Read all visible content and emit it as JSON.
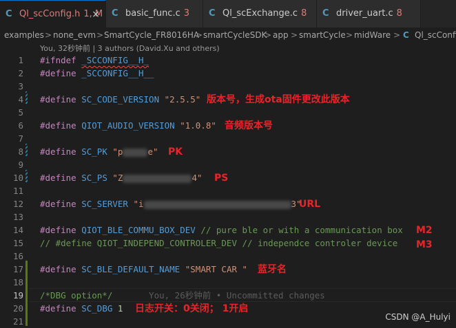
{
  "tabs": [
    {
      "name": "Ql_scConfig.h",
      "suffix": "1, M",
      "close": "×",
      "icon": "C"
    },
    {
      "name": "basic_func.c",
      "suffix": "3",
      "icon": "C"
    },
    {
      "name": "Ql_scExchange.c",
      "suffix": "8",
      "icon": "C"
    },
    {
      "name": "driver_uart.c",
      "suffix": "8",
      "icon": "C"
    }
  ],
  "breadcrumb": [
    "examples",
    "none_evm",
    "SmartCycle_FR8016HA",
    "smartCycleSDK",
    "app",
    "smartCycle",
    "midWare",
    "Ql_scConfi"
  ],
  "breadcrumb_sep": ">",
  "breadcrumb_file_icon": "C",
  "codelens": "You, 32秒钟前 | 3 authors (David.Xu and others)",
  "line_numbers": [
    "1",
    "2",
    "3",
    "4",
    "5",
    "6",
    "7",
    "8",
    "9",
    "10",
    "11",
    "12",
    "13",
    "14",
    "15",
    "16",
    "17",
    "18",
    "19",
    "20",
    "21"
  ],
  "code": {
    "l1_kw": "#ifndef",
    "l1_macro": "_SCCONFIG__H_",
    "l2_kw": "#define",
    "l2_macro": "_SCCONFIG__H__",
    "define": "#define",
    "l4_name": "SC_CODE_VERSION",
    "l4_val": "\"2.5.5\"",
    "l6_name": "QIOT_AUDIO_VERSION",
    "l6_val": "\"1.0.8\"",
    "l8_name": "SC_PK",
    "l8_open": "\"p",
    "l8_close": "e\"",
    "l10_name": "SC_PS",
    "l10_open": "\"Z",
    "l10_close": "4\"",
    "l12_name": "SC_SERVER",
    "l12_open": "\"i",
    "l12_close": "3\"",
    "l14_name": "QIOT_BLE_COMMU_BOX_DEV",
    "l14_comment": "// pure ble or with a communication box",
    "l15_comment": "// #define QIOT_INDEPEND_CONTROLER_DEV // independce controler device",
    "l17_name": "SC_BLE_DEFAULT_NAME",
    "l17_val": "\"SMART CAR \"",
    "l19_comment": "/*DBG option*/",
    "l19_blame": "You, 26秒钟前 • Uncommitted changes",
    "l20_name": "SC_DBG",
    "l20_val": "1"
  },
  "annotations": {
    "version": "版本号，生成ota固件更改此版本",
    "audio": "音频版本号",
    "pk": "PK",
    "ps": "PS",
    "url": "URL",
    "m2": "M2",
    "m3": "M3",
    "ble_name": "蓝牙名",
    "dbg": "日志开关：0关闭； 1开启"
  },
  "watermark": "CSDN @A_Hulyi",
  "colors": {
    "background": "#1e1e1e",
    "keyword": "#c586c0",
    "macro": "#569cd6",
    "string": "#ce9178",
    "number": "#b5cea8",
    "comment": "#6a9955",
    "annotation_red": "#e8242b",
    "active_tab_text": "#e07a77",
    "c_icon": "#519aba"
  }
}
